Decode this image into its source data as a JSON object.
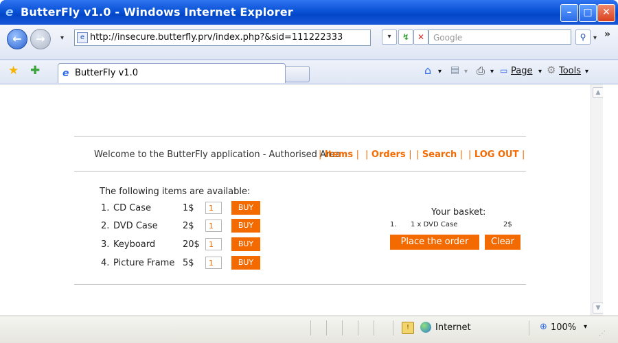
{
  "window": {
    "title": "ButterFly v1.0 - Windows Internet Explorer",
    "icon_glyph": "e",
    "controls": {
      "minimize": "–",
      "maximize": "□",
      "close": "✕"
    }
  },
  "toolbar": {
    "back_glyph": "←",
    "forward_glyph": "→",
    "dropdown_glyph": "▾",
    "address_url": "http://insecure.butterfly.prv/index.php?&sid=111222333",
    "page_icon_glyph": "e",
    "refresh_glyph": "↯",
    "stop_glyph": "✕",
    "search_placeholder": "Google",
    "search_go_glyph": "⚲",
    "address_dropdown_glyph": "▾",
    "overflow_glyph": "»"
  },
  "tabs": {
    "favorites_glyph": "★",
    "add_favorite_glyph": "✚",
    "active_tab_label": "ButterFly v1.0",
    "active_tab_icon": "e",
    "commands": {
      "home_glyph": "⌂",
      "feeds_glyph": "▤",
      "print_glyph": "⎙",
      "page_label": "Page",
      "tools_label": "Tools",
      "dropdown_glyph": "▾"
    }
  },
  "page": {
    "welcome": "Welcome to the ButterFly application - Authorised Area",
    "menu": {
      "items": "Items",
      "orders": "Orders",
      "search": "Search",
      "logout": "LOG OUT",
      "separator": "|"
    },
    "available_heading": "The following items are available:",
    "items": [
      {
        "num": "1.",
        "name": "CD Case",
        "price": "1$",
        "qty": "1",
        "buy": "BUY"
      },
      {
        "num": "2.",
        "name": "DVD Case",
        "price": "2$",
        "qty": "1",
        "buy": "BUY"
      },
      {
        "num": "3.",
        "name": "Keyboard",
        "price": "20$",
        "qty": "1",
        "buy": "BUY"
      },
      {
        "num": "4.",
        "name": "Picture Frame",
        "price": "5$",
        "qty": "1",
        "buy": "BUY"
      }
    ],
    "basket": {
      "title": "Your basket:",
      "lines": [
        {
          "num": "1.",
          "desc": "1 x DVD Case",
          "price": "2$"
        }
      ],
      "place_order": "Place the order",
      "clear": "Clear"
    }
  },
  "scrollbar": {
    "up_glyph": "▲",
    "down_glyph": "▼"
  },
  "status": {
    "zone": "Internet",
    "zoom": "100%",
    "zoom_glyph": "⊕",
    "dropdown_glyph": "▾",
    "protected_glyph": "!"
  },
  "colors": {
    "accent": "#f26a00",
    "titlebar": "#0a52d6"
  }
}
